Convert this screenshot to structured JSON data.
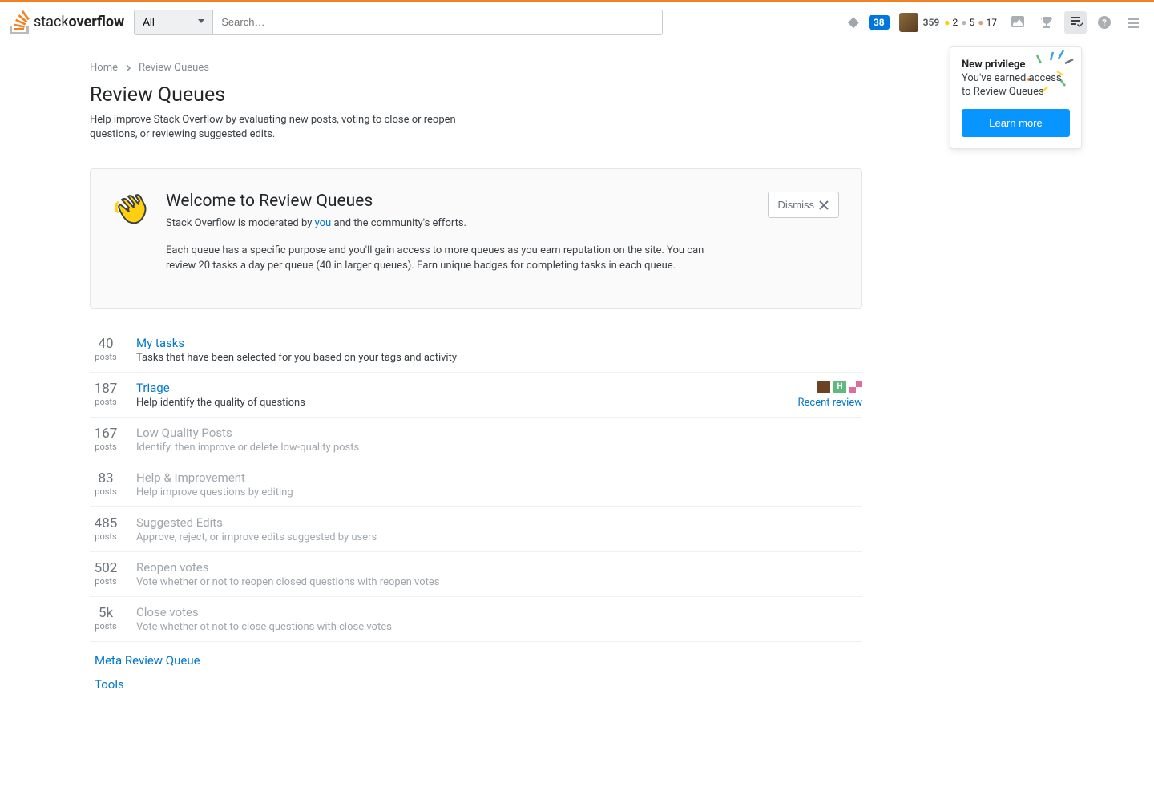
{
  "topbar": {
    "search_filter": "All",
    "search_placeholder": "Search…",
    "notif_badge": "38",
    "reputation": "359",
    "gold": "2",
    "silver": "5",
    "bronze": "17"
  },
  "breadcrumb": {
    "home": "Home",
    "current": "Review Queues"
  },
  "page": {
    "title": "Review Queues",
    "subtitle": "Help improve Stack Overflow by evaluating new posts, voting to close or reopen questions, or reviewing suggested edits."
  },
  "welcome": {
    "title": "Welcome to Review Queues",
    "intro_pre": "Stack Overflow is moderated by ",
    "intro_link": "you",
    "intro_post": " and the community's efforts.",
    "body": "Each queue has a specific purpose and you'll gain access to more queues as you earn reputation on the site. You can review 20 tasks a day per queue (40 in larger queues). Earn unique badges for completing tasks in each queue.",
    "dismiss": "Dismiss"
  },
  "queues": [
    {
      "count": "40",
      "label": "posts",
      "title": "My tasks",
      "desc": "Tasks that have been selected for you based on your tags and activity",
      "active": true,
      "recent": false
    },
    {
      "count": "187",
      "label": "posts",
      "title": "Triage",
      "desc": "Help identify the quality of questions",
      "active": true,
      "recent": true
    },
    {
      "count": "167",
      "label": "posts",
      "title": "Low Quality Posts",
      "desc": "Identify, then improve or delete low-quality posts",
      "active": false,
      "recent": false
    },
    {
      "count": "83",
      "label": "posts",
      "title": "Help & Improvement",
      "desc": "Help improve questions by editing",
      "active": false,
      "recent": false
    },
    {
      "count": "485",
      "label": "posts",
      "title": "Suggested Edits",
      "desc": "Approve, reject, or improve edits suggested by users",
      "active": false,
      "recent": false
    },
    {
      "count": "502",
      "label": "posts",
      "title": "Reopen votes",
      "desc": "Vote whether or not to reopen closed questions with reopen votes",
      "active": false,
      "recent": false
    },
    {
      "count": "5k",
      "label": "posts",
      "title": "Close votes",
      "desc": "Vote whether ot not to close questions with close votes",
      "active": false,
      "recent": false
    }
  ],
  "recent_review_label": "Recent review",
  "bottom": {
    "meta": "Meta Review Queue",
    "tools": "Tools"
  },
  "popup": {
    "title": "New privilege",
    "body": "You've earned access to Review Queues",
    "button": "Learn more"
  }
}
